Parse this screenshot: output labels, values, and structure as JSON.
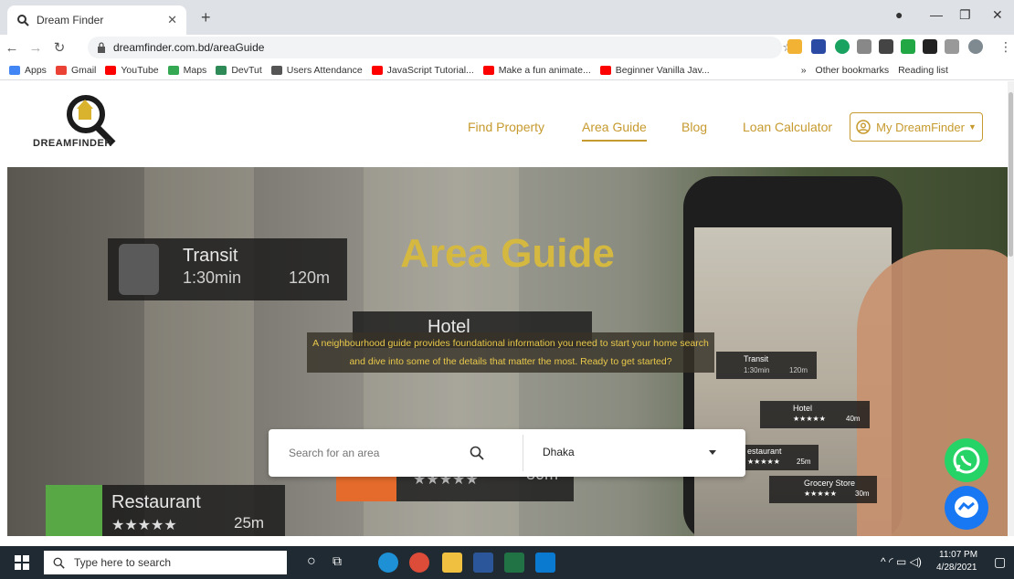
{
  "browser": {
    "tab_title": "Dream Finder",
    "new_tab": "+",
    "url": "dreamfinder.com.bd/areaGuide",
    "bookmarks": [
      {
        "label": "Apps",
        "color": "#4285f4"
      },
      {
        "label": "Gmail",
        "color": "#ea4335"
      },
      {
        "label": "YouTube",
        "color": "#ff0000"
      },
      {
        "label": "Maps",
        "color": "#34a853"
      },
      {
        "label": "DevTut",
        "color": "#2e8b57"
      },
      {
        "label": "Users Attendance",
        "color": "#555555"
      },
      {
        "label": "JavaScript Tutorial...",
        "color": "#ff0000"
      },
      {
        "label": "Make a fun animate...",
        "color": "#ff0000"
      },
      {
        "label": "Beginner Vanilla Jav...",
        "color": "#ff0000"
      }
    ],
    "bookmarks_more": "»",
    "other_bookmarks": "Other bookmarks",
    "reading_list": "Reading list"
  },
  "site": {
    "logo_text": "DREAMFINDER",
    "nav": [
      {
        "label": "Find Property",
        "active": false
      },
      {
        "label": "Area Guide",
        "active": true
      },
      {
        "label": "Blog",
        "active": false
      },
      {
        "label": "Loan Calculator",
        "active": false
      }
    ],
    "account_button": "My DreamFinder",
    "accent_color": "#c69a2e"
  },
  "hero": {
    "title": "Area Guide",
    "description": "A neighbourhood guide provides foundational information you need to start your home search and dive into some of the details that matter the most. Ready to get started?",
    "search_placeholder": "Search for an area",
    "city_selected": "Dhaka",
    "signs": {
      "transit_title": "Transit",
      "transit_time": "1:30min",
      "transit_dist": "120m",
      "hotel_title": "Hotel",
      "restaurant_title": "Restaurant",
      "restaurant_dist": "25m",
      "stars": "★★★★★",
      "small_transit": "Transit",
      "small_transit_time": "1:30min",
      "small_transit_dist": "120m",
      "small_hotel": "Hotel",
      "small_hotel_dist": "40m",
      "small_restaurant": "estaurant",
      "small_restaurant_dist": "25m",
      "small_grocery": "Grocery Store",
      "small_grocery_dist": "30m",
      "mid_dist": "30m"
    }
  },
  "taskbar": {
    "search_placeholder": "Type here to search",
    "time": "11:07 PM",
    "date": "4/28/2021"
  }
}
